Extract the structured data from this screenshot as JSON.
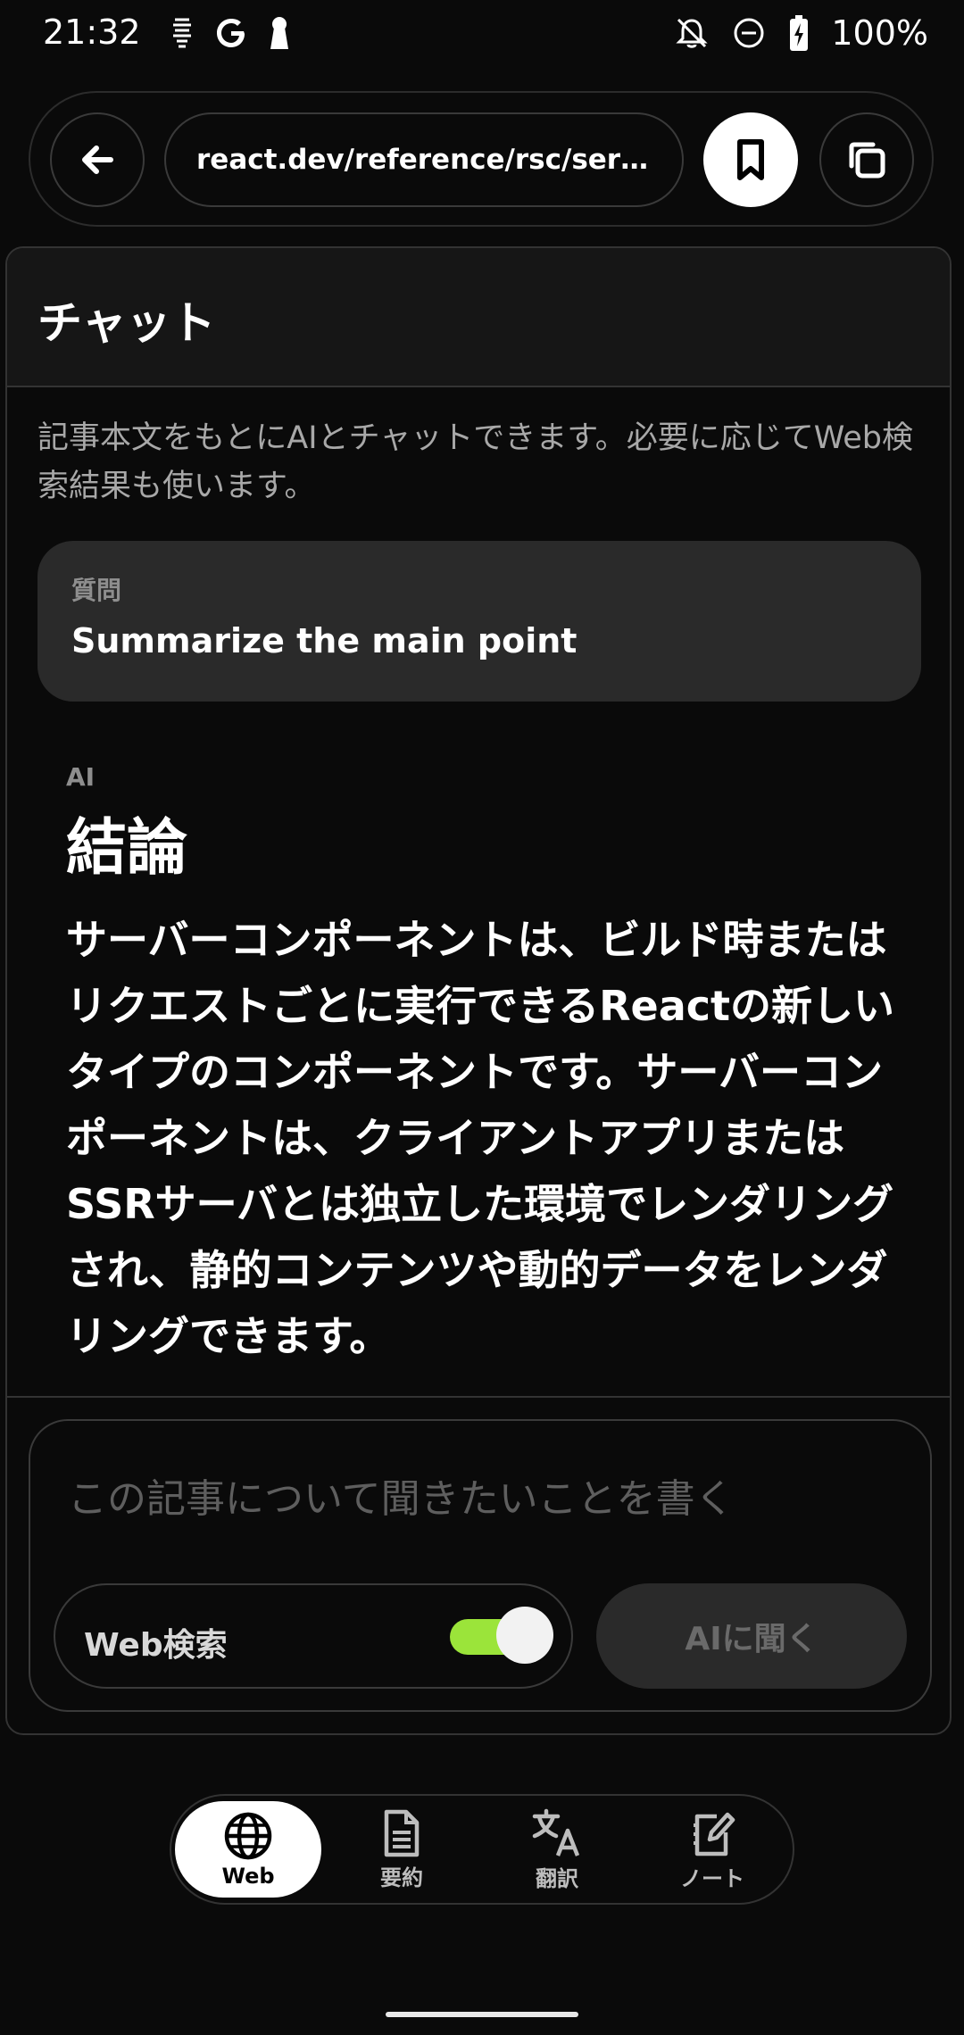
{
  "status_bar": {
    "time": "21:32",
    "battery": "100%",
    "left_icons": [
      "sim-icon",
      "google-icon",
      "keyhole-icon"
    ],
    "right_icons": [
      "notifications-off-icon",
      "do-not-disturb-icon",
      "battery-charging-icon"
    ]
  },
  "browser": {
    "url": "react.dev/reference/rsc/server-..."
  },
  "chat": {
    "title": "チャット",
    "description": "記事本文をもとにAIとチャットできます。必要に応じてWeb検索結果も使います。",
    "question_label": "質問",
    "question_text": "Summarize the main point",
    "ai_label": "AI",
    "answer_heading": "結論",
    "answer_body": "サーバーコンポーネントは、ビルド時またはリクエストごとに実行できるReactの新しいタイプのコンポーネントです。サーバーコンポーネントは、クライアントアプリまたはSSRサーバとは独立した環境でレンダリングされ、静的コンテンツや動的データをレンダリングできます。"
  },
  "composer": {
    "placeholder": "この記事について聞きたいことを書く",
    "web_search_label": "Web検索",
    "web_search_enabled": true,
    "ask_button": "AIに聞く"
  },
  "bottom_nav": {
    "items": [
      {
        "label": "Web",
        "icon": "globe-icon",
        "active": true
      },
      {
        "label": "要約",
        "icon": "document-icon",
        "active": false
      },
      {
        "label": "翻訳",
        "icon": "translate-icon",
        "active": false
      },
      {
        "label": "ノート",
        "icon": "note-edit-icon",
        "active": false
      }
    ]
  },
  "colors": {
    "background": "#0a0a0a",
    "toggle_on": "#9be43a"
  }
}
